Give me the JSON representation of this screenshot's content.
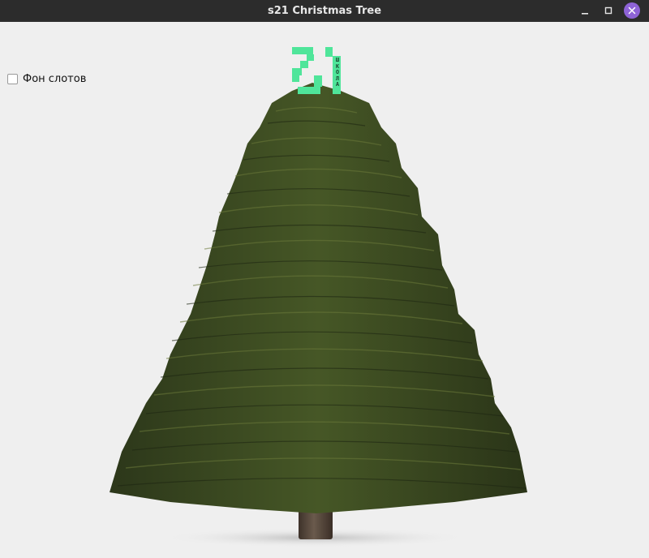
{
  "window": {
    "title": "s21 Christmas Tree",
    "controls": {
      "minimize_icon": "minimize-icon",
      "maximize_icon": "maximize-icon",
      "close_icon": "close-icon"
    }
  },
  "options": {
    "slot_background_label": "Фон слотов",
    "slot_background_checked": false
  },
  "logo": {
    "number": "21",
    "side_text": "ШКОЛА",
    "color": "#4fe59a"
  },
  "colors": {
    "titlebar": "#2c2c2c",
    "background": "#efefef",
    "close_button": "#8e63d6",
    "foliage": "#3d4a22",
    "trunk": "#5a4a3e"
  }
}
